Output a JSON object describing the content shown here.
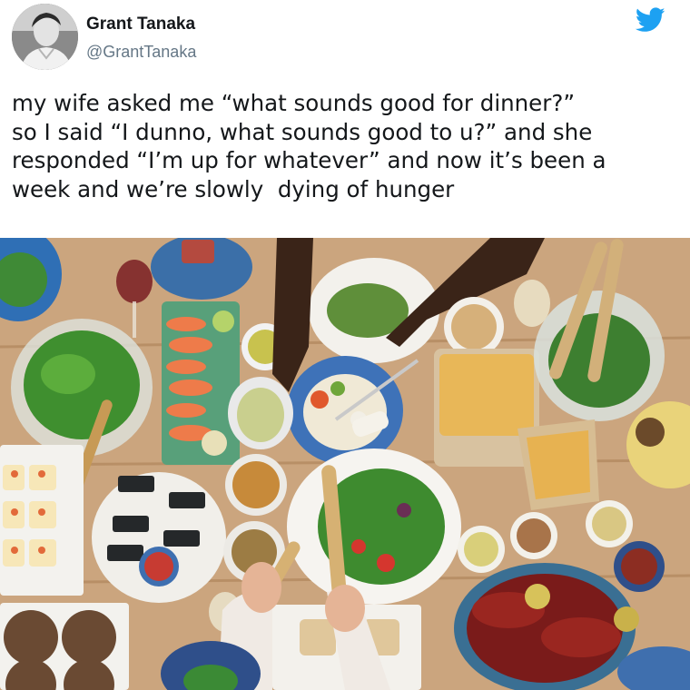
{
  "tweet": {
    "author": {
      "name": "Grant Tanaka",
      "handle": "@GrantTanaka"
    },
    "text": "my wife asked me “what sounds good for dinner?”\nso I said “I dunno, what sounds good to u?” and she\nresponded “I’m up for whatever” and now it’s been a\nweek and we’re slowly  dying of hunger",
    "platform_icon": "twitter-bird-icon",
    "brand_color": "#1DA1F2"
  },
  "photo": {
    "table_color": "#c9a27b"
  }
}
